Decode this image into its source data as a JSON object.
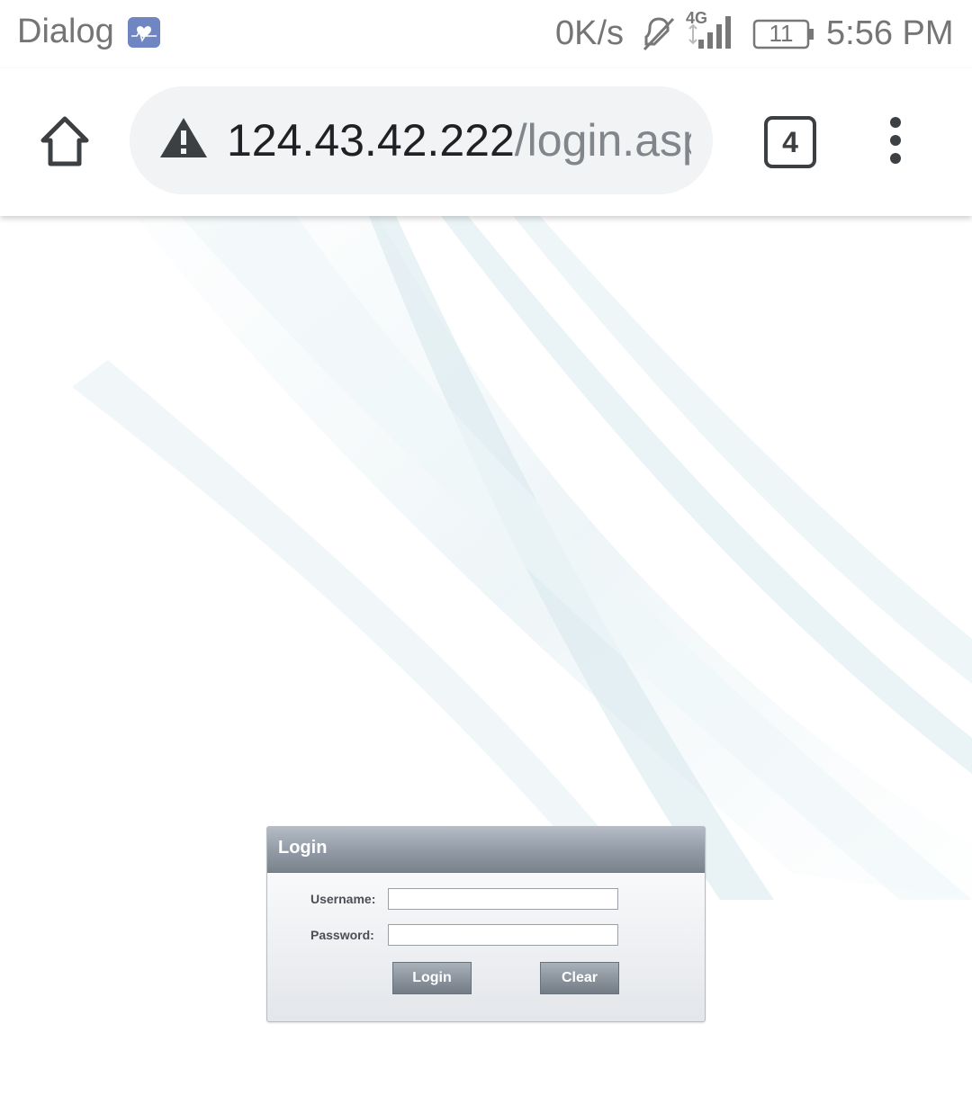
{
  "status_bar": {
    "carrier": "Dialog",
    "network_speed": "0K/s",
    "network_type": "4G",
    "battery_level": "11",
    "time": "5:56 PM",
    "icons": [
      "health-icon",
      "mute-icon",
      "signal-icon",
      "battery-icon"
    ]
  },
  "browser": {
    "url_host": "124.43.42.222",
    "url_path": "/login.asp",
    "tab_count": "4",
    "icons": [
      "home-icon",
      "warning-icon",
      "tabs-icon",
      "menu-icon"
    ]
  },
  "login_form": {
    "title": "Login",
    "username_label": "Username:",
    "password_label": "Password:",
    "username_value": "",
    "password_value": "",
    "login_button": "Login",
    "clear_button": "Clear"
  },
  "colors": {
    "accent_icon": "#6f86c2",
    "panel_header": "#8d959f",
    "url_bar_bg": "#f1f3f4",
    "wave_tint": "#cfe3ea"
  }
}
